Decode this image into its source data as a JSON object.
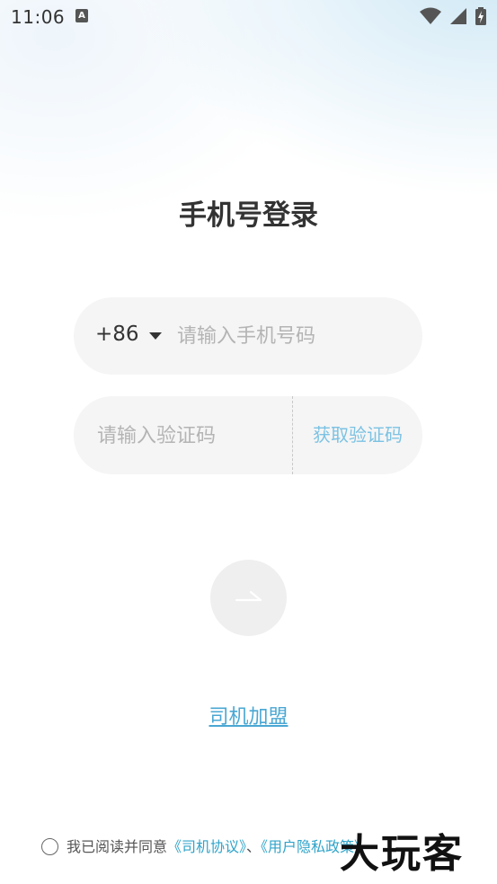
{
  "status_bar": {
    "time": "11:06",
    "notification_icon": "a-notification-icon",
    "wifi_icon": "wifi-icon",
    "signal_icon": "cell-signal-icon",
    "battery_icon": "battery-charging-icon"
  },
  "page": {
    "title": "手机号登录"
  },
  "phone_field": {
    "country_code": "+86",
    "placeholder": "请输入手机号码",
    "value": ""
  },
  "code_field": {
    "placeholder": "请输入验证码",
    "value": "",
    "get_code_label": "获取验证码"
  },
  "submit": {
    "icon": "arrow-right-icon"
  },
  "driver_join": {
    "label": "司机加盟"
  },
  "agreement": {
    "checked": false,
    "prefix": "我已阅读并同意",
    "driver_agreement": "《司机协议》",
    "separator": "、",
    "privacy_policy": "《用户隐私政策》"
  },
  "watermark": {
    "text": "大玩客"
  },
  "colors": {
    "accent": "#7cc2e3",
    "link": "#4aa7d3",
    "field_bg": "#f5f5f5",
    "title": "#333333"
  }
}
